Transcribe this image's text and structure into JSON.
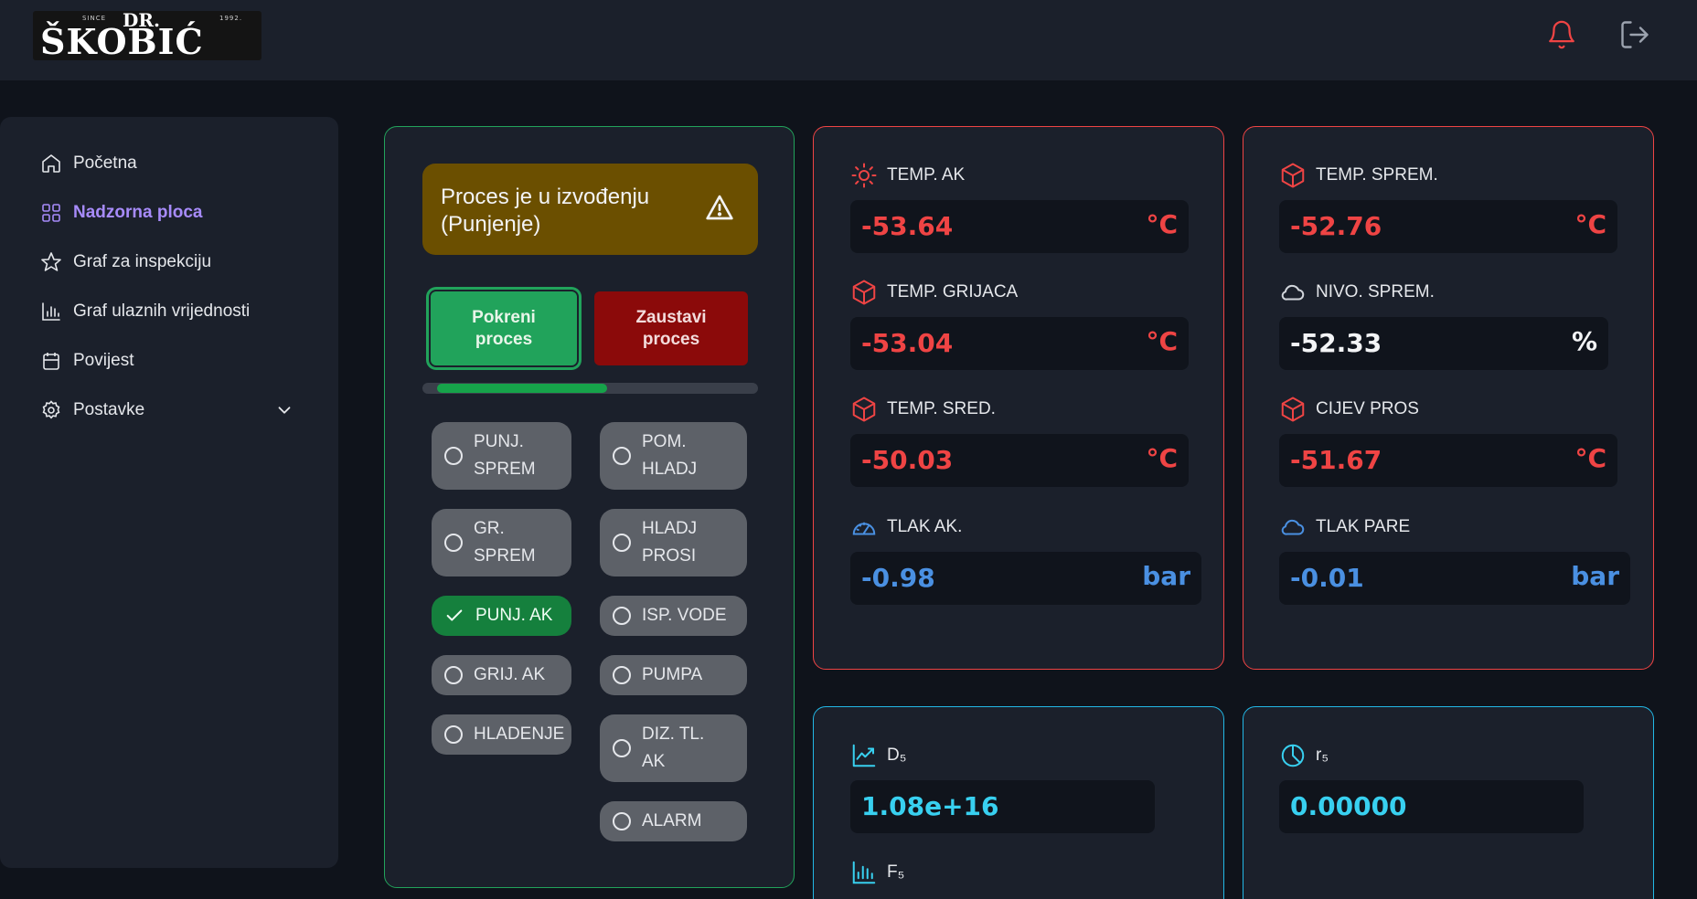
{
  "header": {
    "logo": {
      "since": "SINCE",
      "year": "1992.",
      "dr": "DR.",
      "name": "ŠKOBIĆ"
    }
  },
  "sidebar": {
    "items": [
      {
        "label": "Početna",
        "icon": "home-icon"
      },
      {
        "label": "Nadzorna ploca",
        "icon": "grid-icon",
        "active": true
      },
      {
        "label": "Graf za inspekciju",
        "icon": "star-icon"
      },
      {
        "label": "Graf ulaznih vrijednosti",
        "icon": "bar-chart-icon"
      },
      {
        "label": "Povijest",
        "icon": "calendar-icon"
      },
      {
        "label": "Postavke",
        "icon": "gear-icon"
      }
    ]
  },
  "process": {
    "status": "Proces je u izvođenju (Punjenje)",
    "start_label": "Pokreni proces",
    "stop_label": "Zaustavi proces",
    "progress": 0.55,
    "steps": [
      {
        "label": "PUNJ. SPREM",
        "active": false
      },
      {
        "label": "POM. HLADJ",
        "active": false
      },
      {
        "label": "GR. SPREM",
        "active": false
      },
      {
        "label": "HLADJ PROSI",
        "active": false
      },
      {
        "label": "PUNJ. AK",
        "active": true
      },
      {
        "label": "ISP. VODE",
        "active": false
      },
      {
        "label": "GRIJ. AK",
        "active": false
      },
      {
        "label": "PUMPA",
        "active": false
      },
      {
        "label": "HLADENJE",
        "active": false
      },
      {
        "label": "DIZ. TL. AK",
        "active": false
      },
      {
        "label": "ALARM",
        "active": false
      }
    ]
  },
  "sensors_ak": [
    {
      "label": "TEMP. AK",
      "value": "-53.64",
      "unit": "°C",
      "icon": "sun-icon",
      "color": "#ef4444"
    },
    {
      "label": "TEMP. GRIJACA",
      "value": "-53.04",
      "unit": "°C",
      "icon": "cube-icon",
      "color": "#ef4444"
    },
    {
      "label": "TEMP. SRED.",
      "value": "-50.03",
      "unit": "°C",
      "icon": "cube-icon",
      "color": "#ef4444"
    },
    {
      "label": "TLAK AK.",
      "value": "-0.98",
      "unit": "bar",
      "icon": "gauge-icon",
      "color": "#4a90e2"
    }
  ],
  "sensors_sprem": [
    {
      "label": "TEMP. SPREM.",
      "value": "-52.76",
      "unit": "°C",
      "icon": "cube-icon",
      "color": "#ef4444"
    },
    {
      "label": "NIVO. SPREM.",
      "value": "-52.33",
      "unit": "%",
      "icon": "cloud-icon",
      "color": "#f3f4f6"
    },
    {
      "label": "CIJEV PROS",
      "value": "-51.67",
      "unit": "°C",
      "icon": "cube-icon",
      "color": "#ef4444"
    },
    {
      "label": "TLAK PARE",
      "value": "-0.01",
      "unit": "bar",
      "icon": "cloud-icon",
      "color": "#4a90e2"
    }
  ],
  "calc": {
    "d5": {
      "label": "D₅",
      "value": "1.08e+16",
      "icon": "trend-chart-icon"
    },
    "f5": {
      "label": "F₅",
      "icon": "bar-chart-icon"
    },
    "r5": {
      "label": "r₅",
      "value": "0.00000",
      "icon": "pie-chart-icon"
    }
  }
}
